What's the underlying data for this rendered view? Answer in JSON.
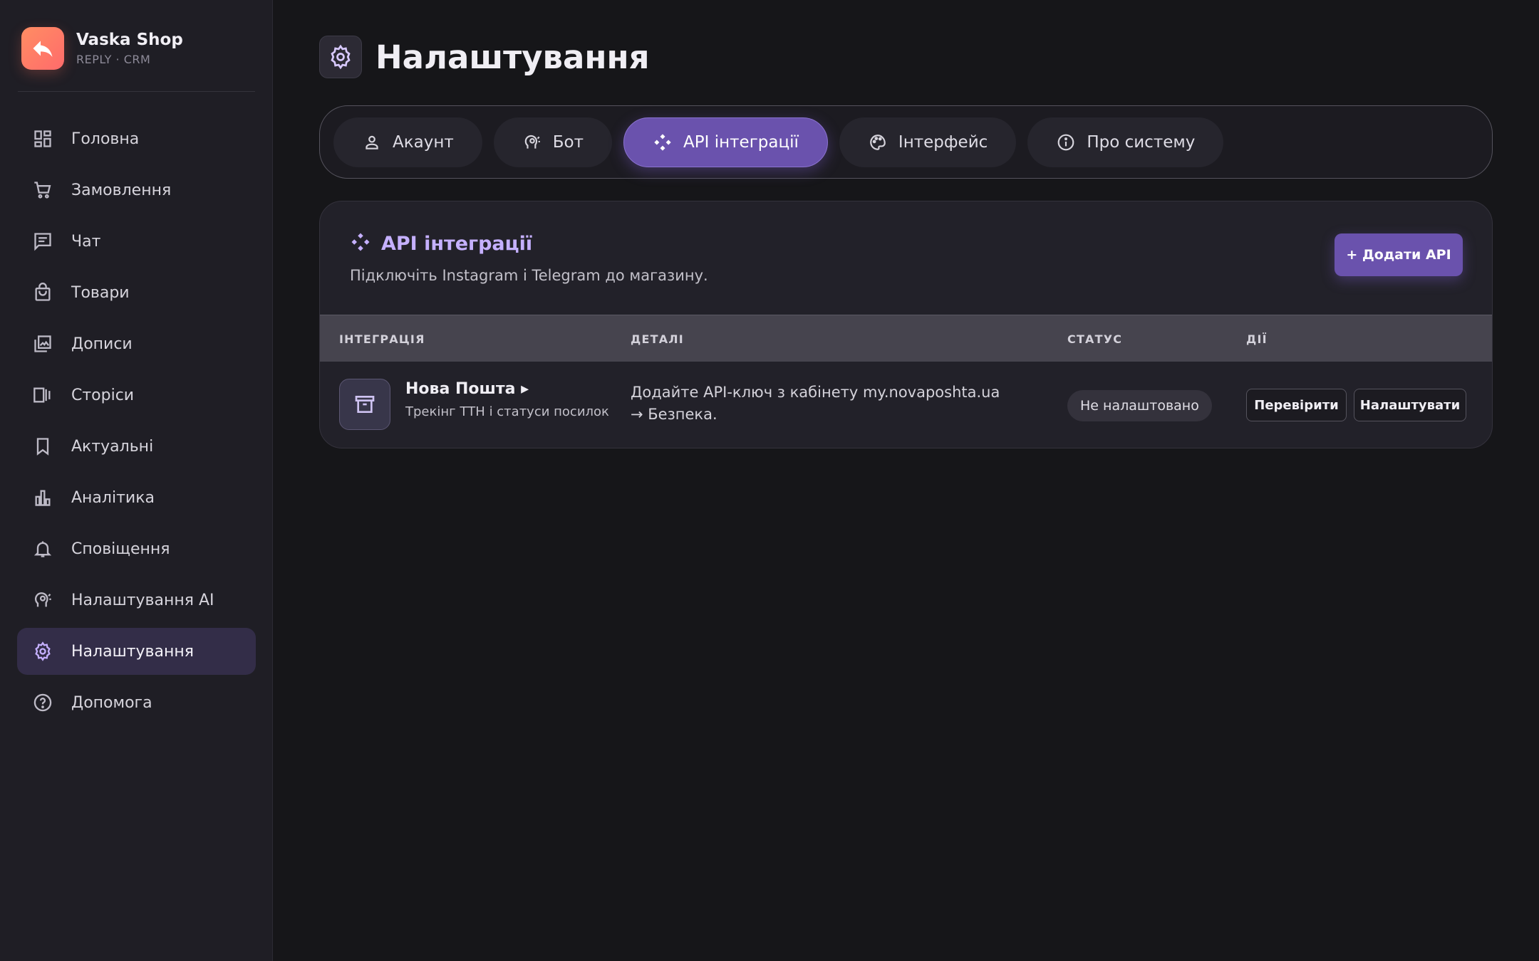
{
  "brand": {
    "name": "Vaska Shop",
    "subtitle": "REPLY · CRM",
    "logo_icon": "reply-arrow-icon",
    "logo_color": "#ff7a5f"
  },
  "sidebar": {
    "items": [
      {
        "label": "Головна",
        "icon": "dashboard-icon",
        "active": false
      },
      {
        "label": "Замовлення",
        "icon": "cart-icon",
        "active": false
      },
      {
        "label": "Чат",
        "icon": "chat-icon",
        "active": false
      },
      {
        "label": "Товари",
        "icon": "shopping-bag-icon",
        "active": false
      },
      {
        "label": "Дописи",
        "icon": "photo-library-icon",
        "active": false
      },
      {
        "label": "Сторіси",
        "icon": "stories-icon",
        "active": false
      },
      {
        "label": "Актуальні",
        "icon": "bookmark-icon",
        "active": false
      },
      {
        "label": "Аналітика",
        "icon": "bar-chart-icon",
        "active": false
      },
      {
        "label": "Сповіщення",
        "icon": "bell-icon",
        "active": false
      },
      {
        "label": "Налаштування AI",
        "icon": "ai-head-icon",
        "active": false
      },
      {
        "label": "Налаштування",
        "icon": "gear-icon",
        "active": true
      },
      {
        "label": "Допомога",
        "icon": "help-icon",
        "active": false
      }
    ]
  },
  "page": {
    "title": "Налаштування",
    "icon": "gear-icon"
  },
  "tabs": [
    {
      "label": "Акаунт",
      "icon": "person-icon",
      "active": false
    },
    {
      "label": "Бот",
      "icon": "ai-head-icon",
      "active": false
    },
    {
      "label": "API інтеграції",
      "icon": "api-icon",
      "active": true
    },
    {
      "label": "Інтерфейс",
      "icon": "palette-icon",
      "active": false
    },
    {
      "label": "Про систему",
      "icon": "info-icon",
      "active": false
    }
  ],
  "card": {
    "title": "API інтеграції",
    "description": "Підключіть Instagram і Telegram до магазину.",
    "add_button": "+ Додати API",
    "columns": [
      "ІНТЕГРАЦІЯ",
      "ДЕТАЛІ",
      "СТАТУС",
      "ДІЇ"
    ],
    "rows": [
      {
        "name": "Нова Пошта ▸",
        "subtitle": "Трекінг ТТН і статуси посилок",
        "icon": "archive-box-icon",
        "details": "Додайте API-ключ з кабінету my.novaposhta.ua → Безпека.",
        "status": "Не налаштовано",
        "actions": [
          "Перевірити",
          "Налаштувати"
        ]
      }
    ]
  },
  "colors": {
    "accent": "#6a52ad",
    "accent_text": "#c5b0ff",
    "background": "#161619",
    "sidebar": "#1f1e25"
  }
}
